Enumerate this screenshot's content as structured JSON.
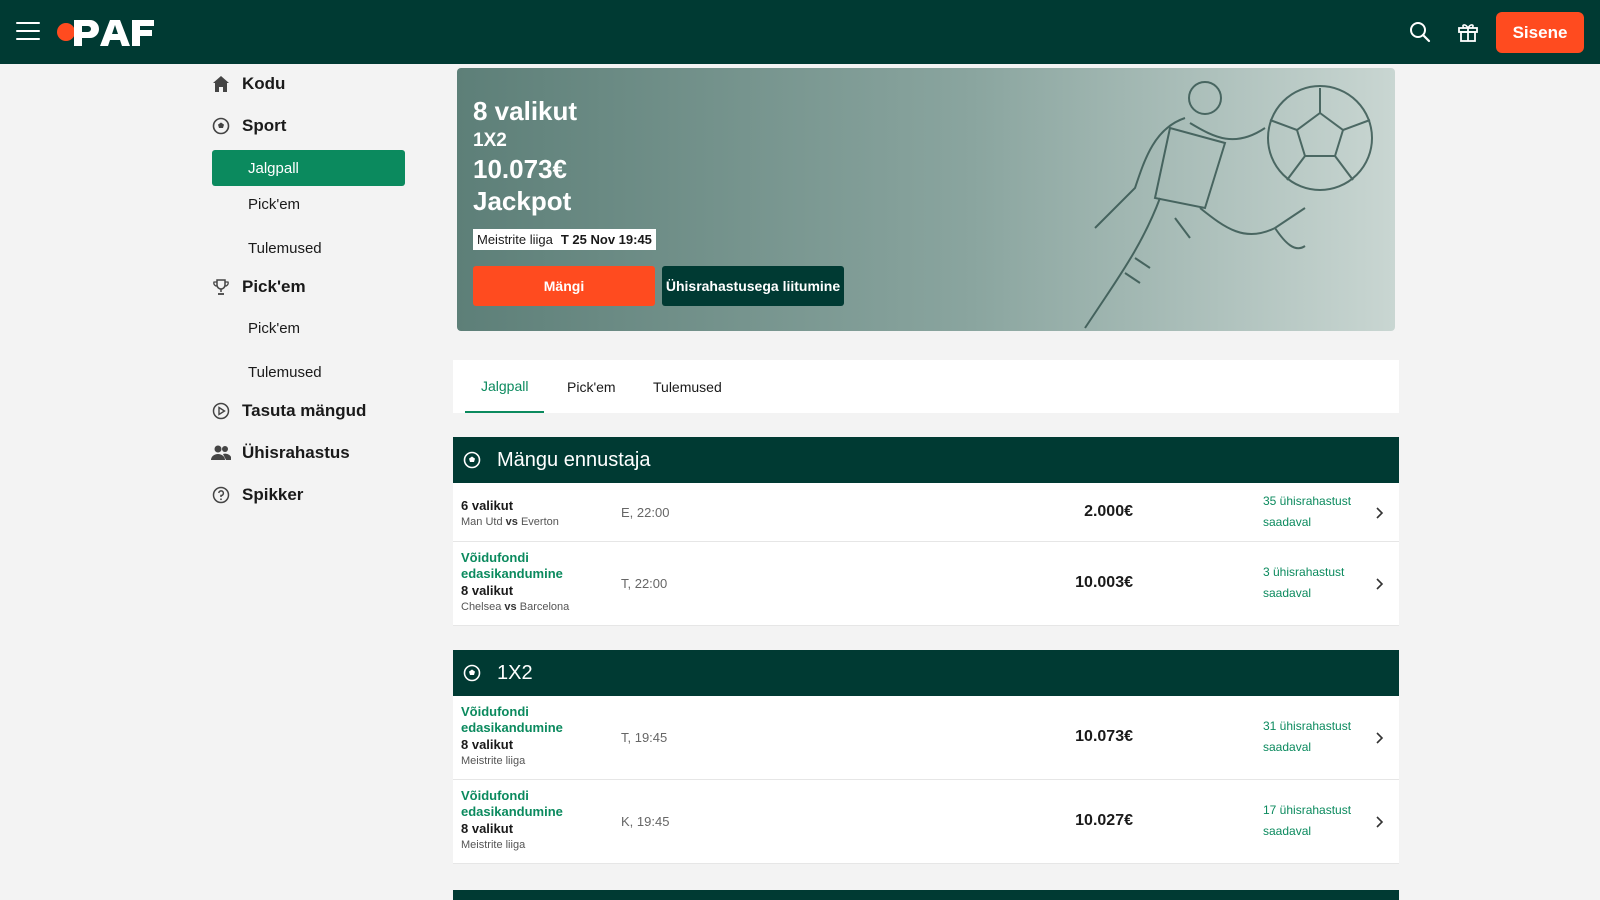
{
  "header": {
    "logo_text": "PAF",
    "login_label": "Sisene",
    "icons": [
      "hamburger-icon",
      "search-icon",
      "gift-icon"
    ],
    "colors": {
      "bar": "#003a33",
      "accent": "#ff4b1f",
      "green": "#0b8a5e"
    }
  },
  "sidebar": {
    "home": "Kodu",
    "sport": "Sport",
    "sport_items": [
      "Jalgpall",
      "Pick'em",
      "Tulemused"
    ],
    "pickem": "Pick'em",
    "pickem_items": [
      "Pick'em",
      "Tulemused"
    ],
    "free_games": "Tasuta mängud",
    "syndicate": "Ühisrahastus",
    "help": "Spikker"
  },
  "hero": {
    "line1": "8 valikut",
    "line2": "1X2",
    "line3": "10.073€",
    "line4": "Jackpot",
    "league": "Meistrite liiga",
    "date": "T 25 Nov 19:45",
    "play_label": "Mängi",
    "join_label": "Ühisrahastusega liitumine"
  },
  "tabs": [
    "Jalgpall",
    "Pick'em",
    "Tulemused"
  ],
  "sections": [
    {
      "title": "Mängu ennustaja",
      "rows": [
        {
          "promo": "",
          "title": "6 valikut",
          "home": "Man Utd",
          "vs": "vs",
          "away": "Everton",
          "league": "",
          "time": "E, 22:00",
          "amount": "2.000€",
          "pools": "35 ühisrahastust saadaval"
        },
        {
          "promo": "Võidufondi edasikandumine",
          "title": "8 valikut",
          "home": "Chelsea",
          "vs": "vs",
          "away": "Barcelona",
          "league": "",
          "time": "T, 22:00",
          "amount": "10.003€",
          "pools": "3 ühisrahastust saadaval"
        }
      ]
    },
    {
      "title": "1X2",
      "rows": [
        {
          "promo": "Võidufondi edasikandumine",
          "title": "8 valikut",
          "league": "Meistrite liiga",
          "time": "T, 19:45",
          "amount": "10.073€",
          "pools": "31 ühisrahastust saadaval"
        },
        {
          "promo": "Võidufondi edasikandumine",
          "title": "8 valikut",
          "league": "Meistrite liiga",
          "time": "K, 19:45",
          "amount": "10.027€",
          "pools": "17 ühisrahastust saadaval"
        }
      ]
    }
  ]
}
